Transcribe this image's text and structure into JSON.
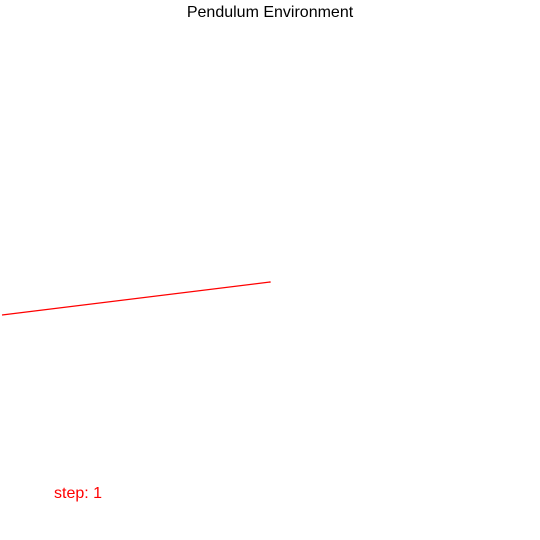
{
  "title": "Pendulum Environment",
  "step_label": "step: 1",
  "pendulum": {
    "color": "#ff0000"
  },
  "colors": {
    "background": "#ffffff",
    "title": "#000000",
    "step_text": "#ff0000"
  }
}
